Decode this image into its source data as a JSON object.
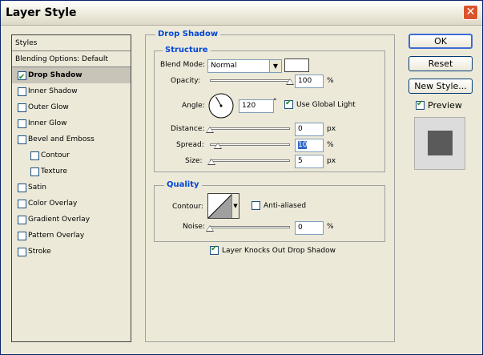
{
  "window": {
    "title": "Layer Style"
  },
  "styles_list": {
    "header": "Styles",
    "items": [
      {
        "label": "Blending Options: Default",
        "checkbox": false,
        "checked": false,
        "indent": 0,
        "selected": false
      },
      {
        "label": "Drop Shadow",
        "checkbox": true,
        "checked": true,
        "indent": 0,
        "selected": true
      },
      {
        "label": "Inner Shadow",
        "checkbox": true,
        "checked": false,
        "indent": 0,
        "selected": false
      },
      {
        "label": "Outer Glow",
        "checkbox": true,
        "checked": false,
        "indent": 0,
        "selected": false
      },
      {
        "label": "Inner Glow",
        "checkbox": true,
        "checked": false,
        "indent": 0,
        "selected": false
      },
      {
        "label": "Bevel and Emboss",
        "checkbox": true,
        "checked": false,
        "indent": 0,
        "selected": false
      },
      {
        "label": "Contour",
        "checkbox": true,
        "checked": false,
        "indent": 1,
        "selected": false
      },
      {
        "label": "Texture",
        "checkbox": true,
        "checked": false,
        "indent": 1,
        "selected": false
      },
      {
        "label": "Satin",
        "checkbox": true,
        "checked": false,
        "indent": 0,
        "selected": false
      },
      {
        "label": "Color Overlay",
        "checkbox": true,
        "checked": false,
        "indent": 0,
        "selected": false
      },
      {
        "label": "Gradient Overlay",
        "checkbox": true,
        "checked": false,
        "indent": 0,
        "selected": false
      },
      {
        "label": "Pattern Overlay",
        "checkbox": true,
        "checked": false,
        "indent": 0,
        "selected": false
      },
      {
        "label": "Stroke",
        "checkbox": true,
        "checked": false,
        "indent": 0,
        "selected": false
      }
    ]
  },
  "drop_shadow": {
    "title": "Drop Shadow",
    "structure": {
      "title": "Structure",
      "blend_mode_label": "Blend Mode:",
      "blend_mode_value": "Normal",
      "shadow_color": "#ffffff",
      "opacity_label": "Opacity:",
      "opacity_value": "100",
      "opacity_fraction": 1.0,
      "opacity_unit": "%",
      "angle_label": "Angle:",
      "angle_value": "120",
      "angle_unit": "°",
      "use_global_light_label": "Use Global Light",
      "use_global_light": true,
      "distance_label": "Distance:",
      "distance_value": "0",
      "distance_fraction": 0.0,
      "distance_unit": "px",
      "spread_label": "Spread:",
      "spread_value": "10",
      "spread_fraction": 0.1,
      "spread_unit": "%",
      "size_label": "Size:",
      "size_value": "5",
      "size_fraction": 0.02,
      "size_unit": "px"
    },
    "quality": {
      "title": "Quality",
      "contour_label": "Contour:",
      "anti_aliased_label": "Anti-aliased",
      "anti_aliased": false,
      "noise_label": "Noise:",
      "noise_value": "0",
      "noise_fraction": 0.0,
      "noise_unit": "%"
    },
    "knockout_label": "Layer Knocks Out Drop Shadow",
    "knockout": true
  },
  "buttons": {
    "ok": "OK",
    "reset": "Reset",
    "new_style": "New Style...",
    "preview_label": "Preview",
    "preview_checked": true
  }
}
